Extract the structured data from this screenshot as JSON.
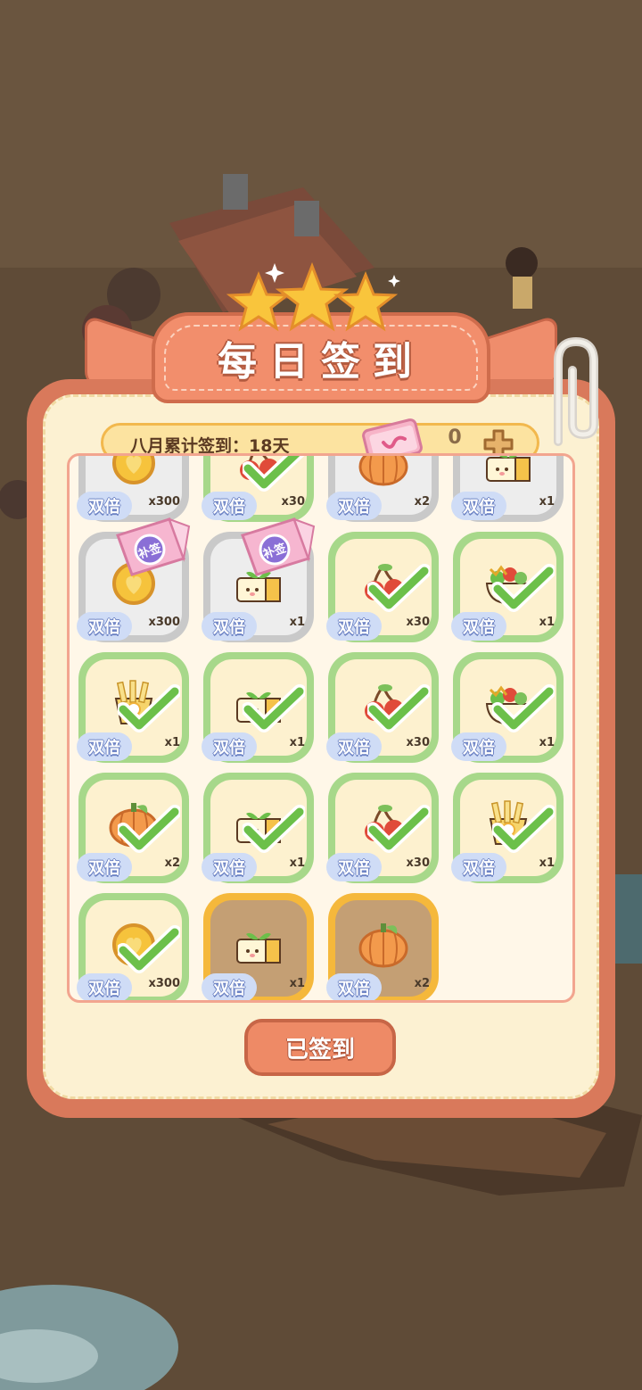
{
  "title": "每日签到",
  "summary": {
    "label": "八月累计签到：18天",
    "ticket_count": "0"
  },
  "badge_text": "双倍",
  "makeup_label": "补签",
  "sign_button": "已签到",
  "rows": [
    [
      {
        "item": "coin",
        "qty": "x300",
        "state": "grey"
      },
      {
        "item": "cherry",
        "qty": "x30",
        "state": "done"
      },
      {
        "item": "pumpkin",
        "qty": "x2",
        "state": "grey"
      },
      {
        "item": "sprout",
        "qty": "x1",
        "state": "grey"
      }
    ],
    [
      {
        "item": "coin",
        "qty": "x300",
        "state": "grey",
        "makeup": true
      },
      {
        "item": "sprout",
        "qty": "x1",
        "state": "grey",
        "makeup": true
      },
      {
        "item": "cherry",
        "qty": "x30",
        "state": "done"
      },
      {
        "item": "salad",
        "qty": "x1",
        "state": "done"
      }
    ],
    [
      {
        "item": "fries",
        "qty": "x1",
        "state": "done"
      },
      {
        "item": "sprout",
        "qty": "x1",
        "state": "done"
      },
      {
        "item": "cherry",
        "qty": "x30",
        "state": "done"
      },
      {
        "item": "salad",
        "qty": "x1",
        "state": "done"
      }
    ],
    [
      {
        "item": "pumpkin",
        "qty": "x2",
        "state": "done"
      },
      {
        "item": "sprout",
        "qty": "x1",
        "state": "done"
      },
      {
        "item": "cherry",
        "qty": "x30",
        "state": "done"
      },
      {
        "item": "fries",
        "qty": "x1",
        "state": "done"
      }
    ],
    [
      {
        "item": "coin",
        "qty": "x300",
        "state": "done"
      },
      {
        "item": "sprout",
        "qty": "x1",
        "state": "today"
      },
      {
        "item": "pumpkin",
        "qty": "x2",
        "state": "today"
      }
    ]
  ],
  "colors": {
    "panel": "#d9795b",
    "inner": "#fcf1d2",
    "done_border": "#a7d88a",
    "today_border": "#f5b83b",
    "check": "#6cc04a"
  }
}
